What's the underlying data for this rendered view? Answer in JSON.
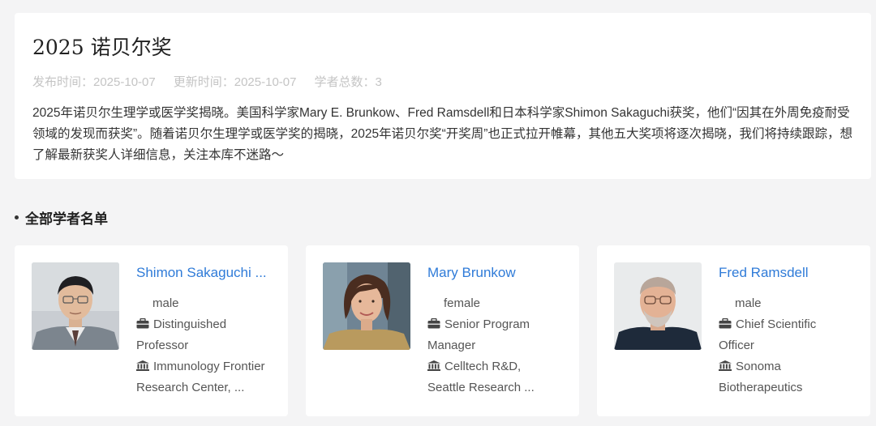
{
  "header": {
    "title": "2025 诺贝尔奖",
    "publish": "发布时间：2025-10-07",
    "update": "更新时间：2025-10-07",
    "count": "学者总数：3",
    "description": "2025年诺贝尔生理学或医学奖揭晓。美国科学家Mary E. Brunkow、Fred Ramsdell和日本科学家Shimon Sakaguchi获奖，他们“因其在外周免疫耐受领域的发现而获奖”。随着诺贝尔生理学或医学奖的揭晓，2025年诺贝尔奖“开奖周”也正式拉开帷幕，其他五大奖项将逐次揭晓，我们将持续跟踪，想了解最新获奖人详细信息，关注本库不迷路～"
  },
  "section": {
    "title": "全部学者名单"
  },
  "scholars": [
    {
      "name": "Shimon Sakaguchi ...",
      "gender": "male",
      "position_line1": "Distinguished",
      "position_line2": "Professor",
      "org_line1": "Immunology Frontier",
      "org_line2": "Research Center, ..."
    },
    {
      "name": "Mary Brunkow",
      "gender": "female",
      "position_line1": "Senior Program",
      "position_line2": "Manager",
      "org_line1": "Celltech R&D,",
      "org_line2": "Seattle Research ..."
    },
    {
      "name": "Fred Ramsdell",
      "gender": "male",
      "position_line1": "Chief Scientific",
      "position_line2": "Officer",
      "org_line1": "Sonoma",
      "org_line2": "Biotherapeutics"
    }
  ],
  "colors": {
    "link": "#2f7bd8",
    "background": "#f4f4f5"
  },
  "icons": {
    "position": "briefcase-icon",
    "org": "institution-icon"
  }
}
